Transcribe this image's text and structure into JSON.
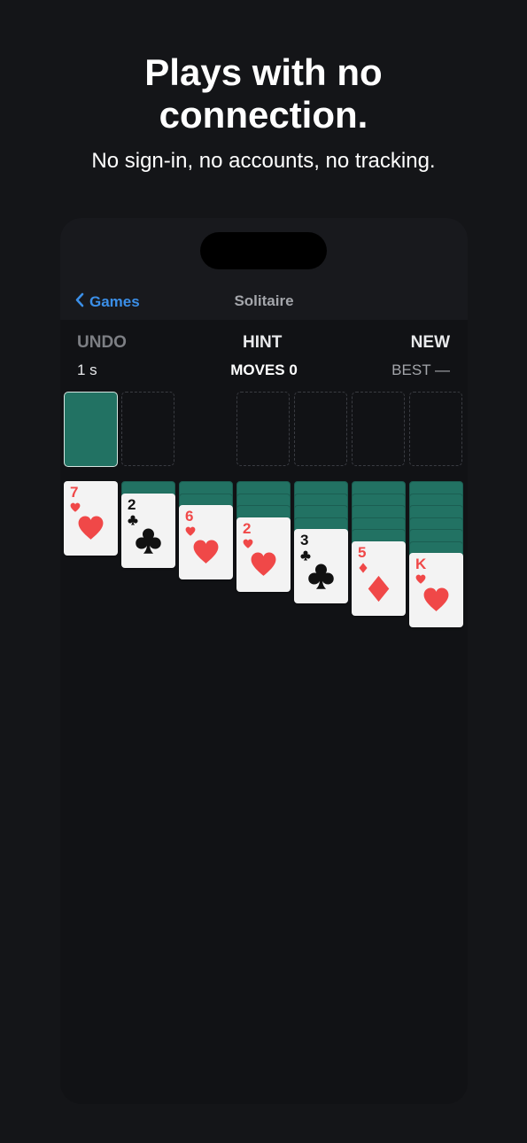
{
  "promo": {
    "headline_line1": "Plays with no",
    "headline_line2": "connection.",
    "subline": "No sign-in, no accounts, no tracking."
  },
  "nav": {
    "back_label": "Games",
    "title": "Solitaire"
  },
  "toolbar": {
    "undo_label": "UNDO",
    "hint_label": "HINT",
    "new_label": "NEW"
  },
  "stats": {
    "time": "1 s",
    "moves": "MOVES 0",
    "best": "BEST —"
  },
  "tableau": [
    {
      "hidden": 0,
      "rank": "7",
      "suit": "hearts"
    },
    {
      "hidden": 1,
      "rank": "2",
      "suit": "clubs"
    },
    {
      "hidden": 2,
      "rank": "6",
      "suit": "hearts"
    },
    {
      "hidden": 3,
      "rank": "2",
      "suit": "hearts"
    },
    {
      "hidden": 4,
      "rank": "3",
      "suit": "clubs"
    },
    {
      "hidden": 5,
      "rank": "5",
      "suit": "diamonds"
    },
    {
      "hidden": 6,
      "rank": "K",
      "suit": "hearts"
    }
  ],
  "colors": {
    "background": "#141518",
    "card_back": "#227263",
    "red_suit": "#f04848",
    "link": "#3b8fe8"
  }
}
